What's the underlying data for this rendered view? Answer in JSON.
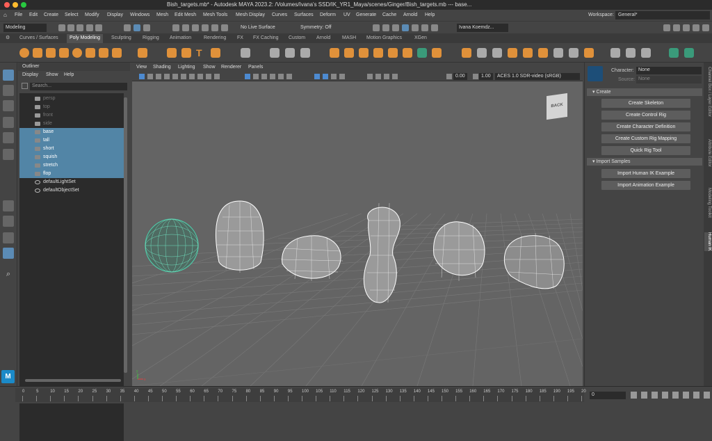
{
  "window": {
    "title": "Bish_targets.mb* - Autodesk MAYA 2023.2: /Volumes/Ivana's SSD/IK_YR1_Maya/scenes/Ginger/Bish_targets.mb   ---   base..."
  },
  "menubar": {
    "items": [
      "File",
      "Edit",
      "Create",
      "Select",
      "Modify",
      "Display",
      "Windows",
      "Mesh",
      "Edit Mesh",
      "Mesh Tools",
      "Mesh Display",
      "Curves",
      "Surfaces",
      "Deform",
      "UV",
      "Generate",
      "Cache",
      "Arnold",
      "Help"
    ],
    "workspace_label": "Workspace:",
    "workspace_value": "General*"
  },
  "statusline": {
    "mode": "Modeling",
    "live_surface": "No Live Surface",
    "symmetry": "Symmetry: Off",
    "user": "Ivana Koemdz..."
  },
  "shelf": {
    "tabs": [
      "Curves / Surfaces",
      "Poly Modeling",
      "Sculpting",
      "Rigging",
      "Animation",
      "Rendering",
      "FX",
      "FX Caching",
      "Custom",
      "Arnold",
      "MASH",
      "Motion Graphics",
      "XGen"
    ],
    "active_tab": "Poly Modeling"
  },
  "outliner": {
    "title": "Outliner",
    "menu": [
      "Display",
      "Show",
      "Help"
    ],
    "search_placeholder": "Search...",
    "items": [
      {
        "label": "persp",
        "type": "camera",
        "state": "dim"
      },
      {
        "label": "top",
        "type": "camera",
        "state": "dim"
      },
      {
        "label": "front",
        "type": "camera",
        "state": "dim"
      },
      {
        "label": "side",
        "type": "camera",
        "state": "dim"
      },
      {
        "label": "base",
        "type": "mesh",
        "state": "selected"
      },
      {
        "label": "tall",
        "type": "mesh",
        "state": "selected"
      },
      {
        "label": "short",
        "type": "mesh",
        "state": "selected"
      },
      {
        "label": "squish",
        "type": "mesh",
        "state": "selected"
      },
      {
        "label": "stretch",
        "type": "mesh",
        "state": "selected"
      },
      {
        "label": "flop",
        "type": "mesh",
        "state": "selected"
      },
      {
        "label": "defaultLightSet",
        "type": "set",
        "state": "normal"
      },
      {
        "label": "defaultObjectSet",
        "type": "set",
        "state": "normal"
      }
    ]
  },
  "viewport": {
    "menu": [
      "View",
      "Shading",
      "Lighting",
      "Show",
      "Renderer",
      "Panels"
    ],
    "value_a": "0.00",
    "value_b": "1.00",
    "color_space": "ACES 1.0 SDR-video (sRGB)",
    "viewcube_label": "BACK",
    "axis_labels": {
      "x": "x",
      "y": "y"
    }
  },
  "hik": {
    "character_label": "Character:",
    "character_value": "None",
    "source_label": "Source:",
    "source_value": "None",
    "create_section": "Create",
    "create_buttons": [
      "Create Skeleton",
      "Create Control Rig",
      "Create Character Definition",
      "Create Custom Rig Mapping",
      "Quick Rig Tool"
    ],
    "import_section": "Import Samples",
    "import_buttons": [
      "Import Human IK Example",
      "Import Animation Example"
    ]
  },
  "right_tabs": [
    "Channel Box / Layer Editor",
    "Attribute Editor",
    "Modeling Toolkit",
    "Human IK"
  ],
  "timeline": {
    "ticks": [
      "0",
      "5",
      "10",
      "15",
      "20",
      "25",
      "30",
      "35",
      "40",
      "45",
      "50",
      "55",
      "60",
      "65",
      "70",
      "75",
      "80",
      "85",
      "90",
      "95",
      "100",
      "105",
      "110",
      "115",
      "120",
      "125",
      "130",
      "135",
      "140",
      "145",
      "150",
      "155",
      "160",
      "165",
      "170",
      "175",
      "180",
      "185",
      "190",
      "195",
      "20"
    ],
    "current_frame": "0"
  },
  "colors": {
    "selection": "#5285a6",
    "shelf_accent": "#e0913a",
    "viewport_bg": "#646464",
    "selected_mesh": "#4fc9a8"
  }
}
